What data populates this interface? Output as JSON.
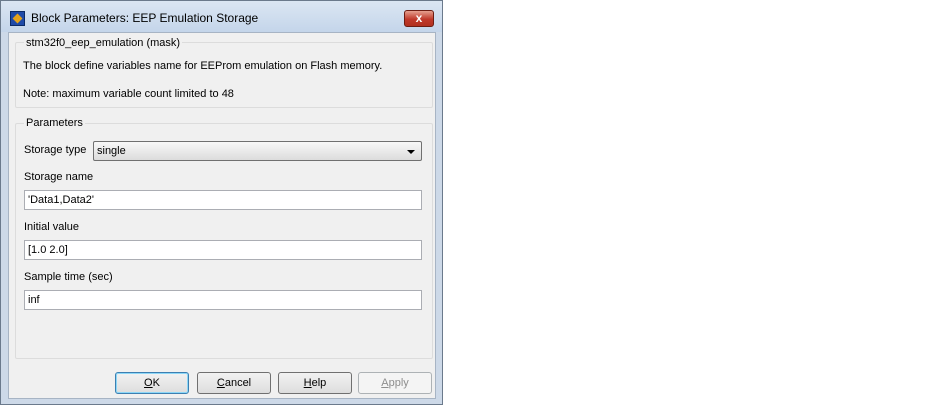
{
  "window": {
    "title": "Block Parameters: EEP Emulation Storage",
    "close_symbol": "x"
  },
  "description": {
    "heading": "stm32f0_eep_emulation (mask)",
    "line1": "The block define variables name for EEProm emulation on Flash memory.",
    "line2": "Note: maximum variable count limited to 48"
  },
  "parameters": {
    "heading": "Parameters",
    "storage_type": {
      "label": "Storage type",
      "value": "single"
    },
    "storage_name": {
      "label": "Storage name",
      "value": "'Data1,Data2'"
    },
    "initial_value": {
      "label": "Initial value",
      "value": "[1.0 2.0]"
    },
    "sample_time": {
      "label": "Sample time (sec)",
      "value": "inf"
    }
  },
  "buttons": {
    "ok": {
      "mnemonic": "O",
      "rest": "K"
    },
    "cancel": {
      "mnemonic": "C",
      "rest": "ancel"
    },
    "help": {
      "mnemonic": "H",
      "rest": "elp"
    },
    "apply": {
      "mnemonic": "A",
      "rest": "pply"
    }
  },
  "icons": [
    "simulink-block-icon",
    "close-icon",
    "dropdown-arrow-icon"
  ]
}
